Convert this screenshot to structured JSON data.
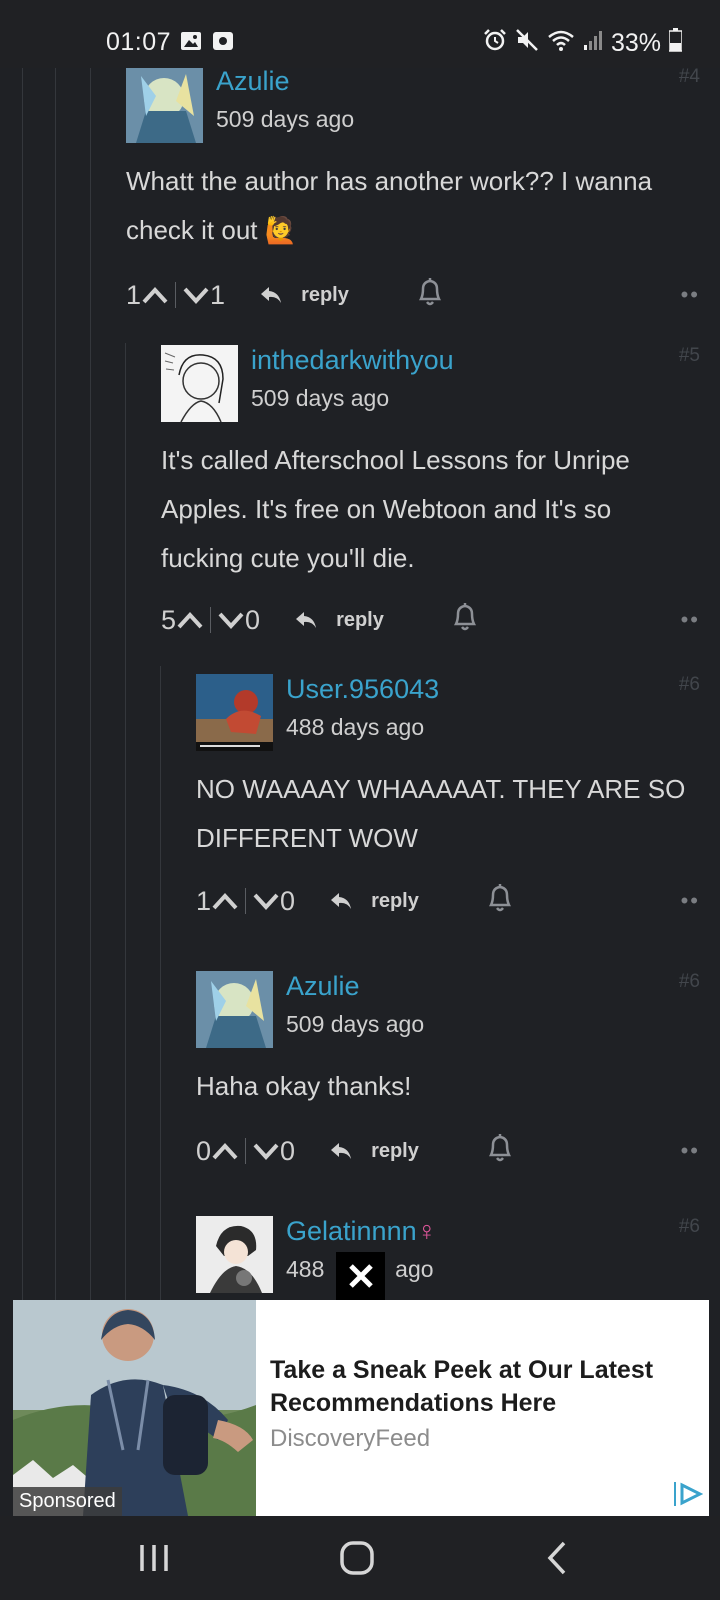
{
  "status_bar": {
    "time": "01:07",
    "battery": "33%"
  },
  "comments": [
    {
      "username": "Azulie",
      "time_ago": "509 days ago",
      "number": "#4",
      "text": "Whatt the author has another work?? I wanna check it out 🙋",
      "upvotes": "1",
      "downvotes": "1",
      "reply_label": "reply"
    },
    {
      "username": "inthedarkwithyou",
      "time_ago": "509 days ago",
      "number": "#5",
      "text": "It's called Afterschool Lessons for Unripe Apples. It's free on Webtoon and It's so fucking cute you'll die.",
      "upvotes": "5",
      "downvotes": "0",
      "reply_label": "reply"
    },
    {
      "username": "User.956043",
      "time_ago": "488 days ago",
      "number": "#6",
      "text": "NO WAAAAY WHAAAAAT. THEY ARE SO DIFFERENT WOW",
      "upvotes": "1",
      "downvotes": "0",
      "reply_label": "reply"
    },
    {
      "username": "Azulie",
      "time_ago": "509 days ago",
      "number": "#6",
      "text": "Haha okay thanks!",
      "upvotes": "0",
      "downvotes": "0",
      "reply_label": "reply"
    },
    {
      "username": "Gelatinnnn",
      "time_ago_prefix": "488",
      "time_ago_suffix": "ago",
      "number": "#6",
      "gender_symbol": "♀"
    }
  ],
  "ad": {
    "title": "Take a Sneak Peek at Our Latest Recommendations Here",
    "source": "DiscoveryFeed",
    "sponsored_label": "Sponsored"
  },
  "icons": [
    "image-icon",
    "screenshot-icon",
    "alarm-icon",
    "mute-icon",
    "wifi-icon",
    "signal-icon",
    "battery-icon",
    "upvote-icon",
    "downvote-icon",
    "reply-icon",
    "bell-icon",
    "more-icon",
    "close-icon",
    "adchoices-icon",
    "recent-apps-icon",
    "home-icon",
    "back-icon"
  ],
  "colors": {
    "background": "#1f2125",
    "username": "#3aa3cc",
    "female_symbol": "#e0569b"
  }
}
